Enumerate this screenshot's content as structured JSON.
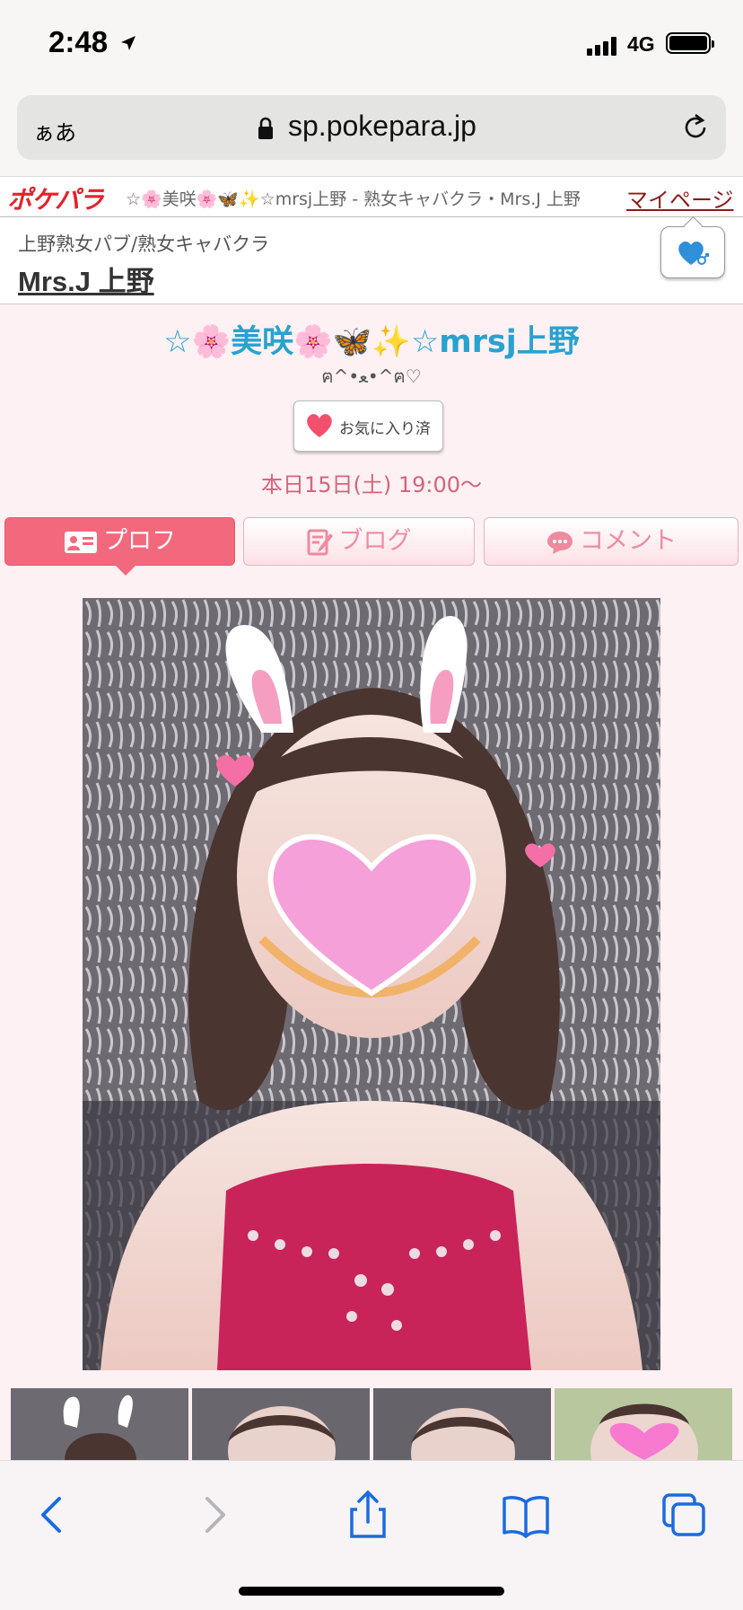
{
  "status_bar": {
    "time": "2:48",
    "network": "4G"
  },
  "browser": {
    "text_size_label": "ぁあ",
    "url": "sp.pokepara.jp"
  },
  "site": {
    "logo": "ポケパラ",
    "page_title": "☆🌸美咲🌸🦋✨☆mrsj上野 - 熟女キャバクラ・Mrs.J 上野",
    "mypage_link": "マイページ",
    "shop_category": "上野熟女パブ/熟女キャバクラ",
    "shop_name": "Mrs.J 上野"
  },
  "profile": {
    "name": "☆🌸美咲🌸🦋✨☆mrsj上野",
    "catchphrase": "ฅ^•ﻌ•^ฅ♡",
    "favorite_button": "お気に入り済",
    "schedule": "本日15日(土) 19:00〜"
  },
  "tabs": [
    {
      "label": "プロフ",
      "icon": "profile-card-icon",
      "active": true
    },
    {
      "label": "ブログ",
      "icon": "blog-edit-icon",
      "active": false
    },
    {
      "label": "コメント",
      "icon": "comment-bubble-icon",
      "active": false
    }
  ],
  "colors": {
    "accent_pink": "#f2697e",
    "name_blue": "#29a2cf",
    "schedule_pink": "#d7627a",
    "logo_red": "#e2232c"
  }
}
